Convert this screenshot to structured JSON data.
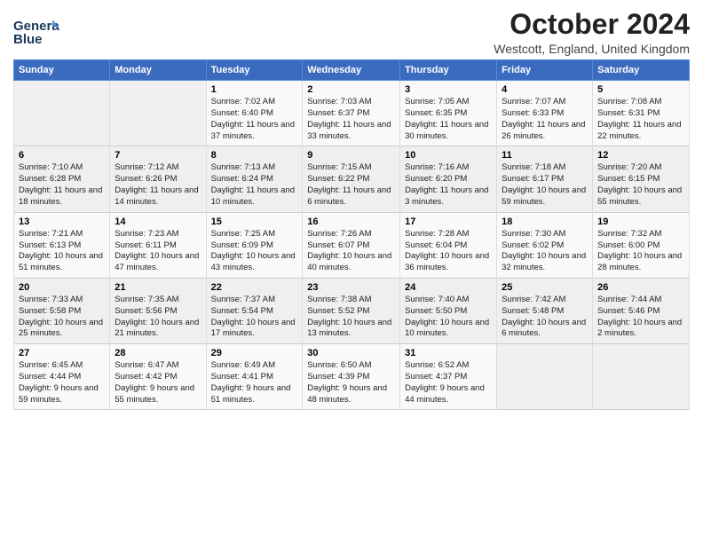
{
  "logo": {
    "line1": "General",
    "line2": "Blue"
  },
  "title": "October 2024",
  "location": "Westcott, England, United Kingdom",
  "days_of_week": [
    "Sunday",
    "Monday",
    "Tuesday",
    "Wednesday",
    "Thursday",
    "Friday",
    "Saturday"
  ],
  "weeks": [
    [
      {
        "day": "",
        "sunrise": "",
        "sunset": "",
        "daylight": ""
      },
      {
        "day": "",
        "sunrise": "",
        "sunset": "",
        "daylight": ""
      },
      {
        "day": "1",
        "sunrise": "Sunrise: 7:02 AM",
        "sunset": "Sunset: 6:40 PM",
        "daylight": "Daylight: 11 hours and 37 minutes."
      },
      {
        "day": "2",
        "sunrise": "Sunrise: 7:03 AM",
        "sunset": "Sunset: 6:37 PM",
        "daylight": "Daylight: 11 hours and 33 minutes."
      },
      {
        "day": "3",
        "sunrise": "Sunrise: 7:05 AM",
        "sunset": "Sunset: 6:35 PM",
        "daylight": "Daylight: 11 hours and 30 minutes."
      },
      {
        "day": "4",
        "sunrise": "Sunrise: 7:07 AM",
        "sunset": "Sunset: 6:33 PM",
        "daylight": "Daylight: 11 hours and 26 minutes."
      },
      {
        "day": "5",
        "sunrise": "Sunrise: 7:08 AM",
        "sunset": "Sunset: 6:31 PM",
        "daylight": "Daylight: 11 hours and 22 minutes."
      }
    ],
    [
      {
        "day": "6",
        "sunrise": "Sunrise: 7:10 AM",
        "sunset": "Sunset: 6:28 PM",
        "daylight": "Daylight: 11 hours and 18 minutes."
      },
      {
        "day": "7",
        "sunrise": "Sunrise: 7:12 AM",
        "sunset": "Sunset: 6:26 PM",
        "daylight": "Daylight: 11 hours and 14 minutes."
      },
      {
        "day": "8",
        "sunrise": "Sunrise: 7:13 AM",
        "sunset": "Sunset: 6:24 PM",
        "daylight": "Daylight: 11 hours and 10 minutes."
      },
      {
        "day": "9",
        "sunrise": "Sunrise: 7:15 AM",
        "sunset": "Sunset: 6:22 PM",
        "daylight": "Daylight: 11 hours and 6 minutes."
      },
      {
        "day": "10",
        "sunrise": "Sunrise: 7:16 AM",
        "sunset": "Sunset: 6:20 PM",
        "daylight": "Daylight: 11 hours and 3 minutes."
      },
      {
        "day": "11",
        "sunrise": "Sunrise: 7:18 AM",
        "sunset": "Sunset: 6:17 PM",
        "daylight": "Daylight: 10 hours and 59 minutes."
      },
      {
        "day": "12",
        "sunrise": "Sunrise: 7:20 AM",
        "sunset": "Sunset: 6:15 PM",
        "daylight": "Daylight: 10 hours and 55 minutes."
      }
    ],
    [
      {
        "day": "13",
        "sunrise": "Sunrise: 7:21 AM",
        "sunset": "Sunset: 6:13 PM",
        "daylight": "Daylight: 10 hours and 51 minutes."
      },
      {
        "day": "14",
        "sunrise": "Sunrise: 7:23 AM",
        "sunset": "Sunset: 6:11 PM",
        "daylight": "Daylight: 10 hours and 47 minutes."
      },
      {
        "day": "15",
        "sunrise": "Sunrise: 7:25 AM",
        "sunset": "Sunset: 6:09 PM",
        "daylight": "Daylight: 10 hours and 43 minutes."
      },
      {
        "day": "16",
        "sunrise": "Sunrise: 7:26 AM",
        "sunset": "Sunset: 6:07 PM",
        "daylight": "Daylight: 10 hours and 40 minutes."
      },
      {
        "day": "17",
        "sunrise": "Sunrise: 7:28 AM",
        "sunset": "Sunset: 6:04 PM",
        "daylight": "Daylight: 10 hours and 36 minutes."
      },
      {
        "day": "18",
        "sunrise": "Sunrise: 7:30 AM",
        "sunset": "Sunset: 6:02 PM",
        "daylight": "Daylight: 10 hours and 32 minutes."
      },
      {
        "day": "19",
        "sunrise": "Sunrise: 7:32 AM",
        "sunset": "Sunset: 6:00 PM",
        "daylight": "Daylight: 10 hours and 28 minutes."
      }
    ],
    [
      {
        "day": "20",
        "sunrise": "Sunrise: 7:33 AM",
        "sunset": "Sunset: 5:58 PM",
        "daylight": "Daylight: 10 hours and 25 minutes."
      },
      {
        "day": "21",
        "sunrise": "Sunrise: 7:35 AM",
        "sunset": "Sunset: 5:56 PM",
        "daylight": "Daylight: 10 hours and 21 minutes."
      },
      {
        "day": "22",
        "sunrise": "Sunrise: 7:37 AM",
        "sunset": "Sunset: 5:54 PM",
        "daylight": "Daylight: 10 hours and 17 minutes."
      },
      {
        "day": "23",
        "sunrise": "Sunrise: 7:38 AM",
        "sunset": "Sunset: 5:52 PM",
        "daylight": "Daylight: 10 hours and 13 minutes."
      },
      {
        "day": "24",
        "sunrise": "Sunrise: 7:40 AM",
        "sunset": "Sunset: 5:50 PM",
        "daylight": "Daylight: 10 hours and 10 minutes."
      },
      {
        "day": "25",
        "sunrise": "Sunrise: 7:42 AM",
        "sunset": "Sunset: 5:48 PM",
        "daylight": "Daylight: 10 hours and 6 minutes."
      },
      {
        "day": "26",
        "sunrise": "Sunrise: 7:44 AM",
        "sunset": "Sunset: 5:46 PM",
        "daylight": "Daylight: 10 hours and 2 minutes."
      }
    ],
    [
      {
        "day": "27",
        "sunrise": "Sunrise: 6:45 AM",
        "sunset": "Sunset: 4:44 PM",
        "daylight": "Daylight: 9 hours and 59 minutes."
      },
      {
        "day": "28",
        "sunrise": "Sunrise: 6:47 AM",
        "sunset": "Sunset: 4:42 PM",
        "daylight": "Daylight: 9 hours and 55 minutes."
      },
      {
        "day": "29",
        "sunrise": "Sunrise: 6:49 AM",
        "sunset": "Sunset: 4:41 PM",
        "daylight": "Daylight: 9 hours and 51 minutes."
      },
      {
        "day": "30",
        "sunrise": "Sunrise: 6:50 AM",
        "sunset": "Sunset: 4:39 PM",
        "daylight": "Daylight: 9 hours and 48 minutes."
      },
      {
        "day": "31",
        "sunrise": "Sunrise: 6:52 AM",
        "sunset": "Sunset: 4:37 PM",
        "daylight": "Daylight: 9 hours and 44 minutes."
      },
      {
        "day": "",
        "sunrise": "",
        "sunset": "",
        "daylight": ""
      },
      {
        "day": "",
        "sunrise": "",
        "sunset": "",
        "daylight": ""
      }
    ]
  ]
}
